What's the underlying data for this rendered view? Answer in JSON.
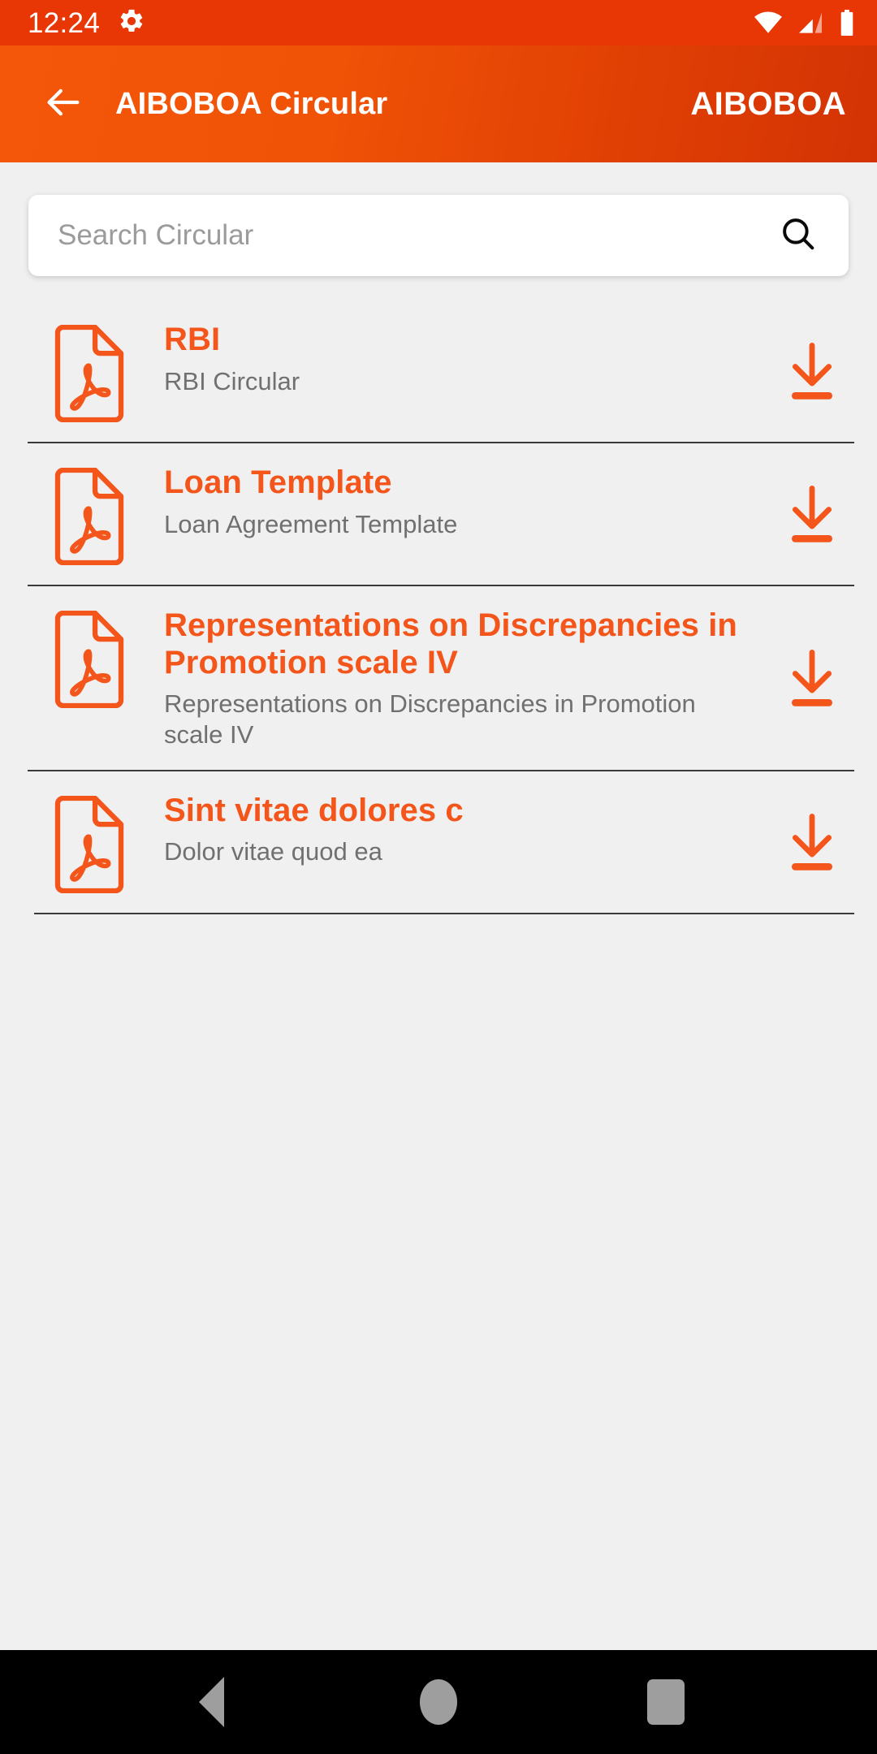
{
  "status_bar": {
    "clock": "12:24",
    "icons": [
      "gear-icon",
      "wifi-icon",
      "cellular-signal-icon",
      "battery-icon"
    ]
  },
  "app_bar": {
    "back_icon": "arrow-left-icon",
    "title": "AIBOBOA Circular",
    "brand": "AIBOBOA"
  },
  "search": {
    "placeholder": "Search Circular",
    "value": "",
    "icon": "search-icon"
  },
  "documents": [
    {
      "title": "RBI",
      "subtitle": "RBI Circular",
      "file_icon": "pdf-file-icon",
      "action_icon": "download-icon"
    },
    {
      "title": "Loan Template",
      "subtitle": "Loan Agreement Template",
      "file_icon": "pdf-file-icon",
      "action_icon": "download-icon"
    },
    {
      "title": "Representations on Discrepancies in Promotion scale IV",
      "subtitle": "Representations on Discrepancies in Promotion scale IV",
      "file_icon": "pdf-file-icon",
      "action_icon": "download-icon"
    },
    {
      "title": "Sint vitae dolores c",
      "subtitle": "Dolor vitae quod ea",
      "file_icon": "pdf-file-icon",
      "action_icon": "download-icon"
    }
  ],
  "nav_bar": {
    "back_label": "Back",
    "home_label": "Home",
    "recents_label": "Recents"
  },
  "colors": {
    "status_bar": "#E93605",
    "app_bar_start": "#F4570A",
    "app_bar_end": "#D33304",
    "accent": "#F4551A",
    "background": "#F0F0F0",
    "subtitle": "#707070",
    "divider": "#3A3A3A",
    "nav_bar": "#000000",
    "nav_icon": "#9E9E9E"
  }
}
